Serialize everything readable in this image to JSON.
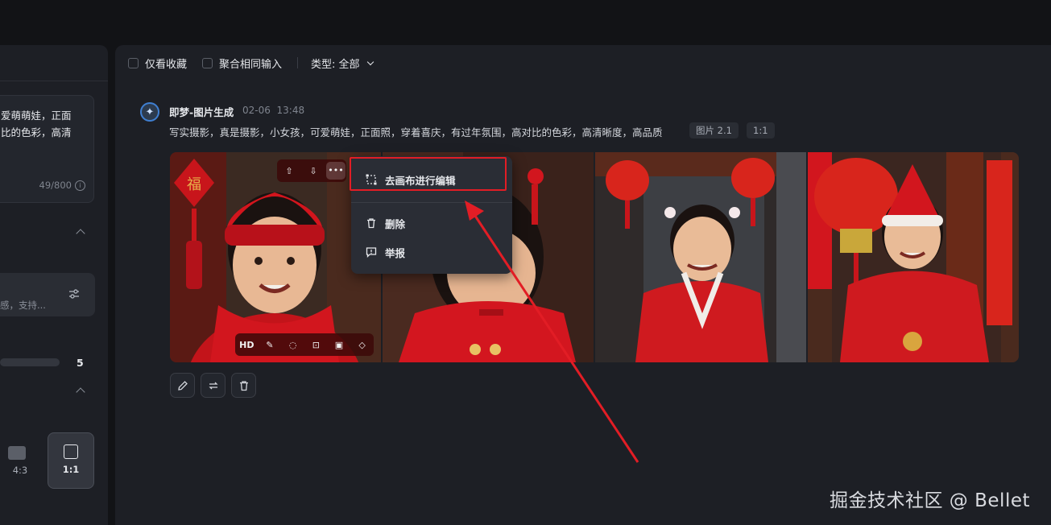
{
  "left_panel": {
    "prompt_text": "爱萌萌娃，正面\n比的色彩，高清",
    "char_count": "49/800",
    "reference_hint": "感，支持...",
    "count_value": "5",
    "ratios": [
      {
        "label": "4:3",
        "selected": false
      },
      {
        "label": "1:1",
        "selected": true
      }
    ]
  },
  "filters": {
    "favorites_only": "仅看收藏",
    "merge_same_input": "聚合相同输入",
    "type_label": "类型: 全部"
  },
  "generation": {
    "title": "即梦-图片生成",
    "date": "02-06",
    "time": "13:48",
    "prompt": "写实摄影，真是摄影，小女孩，可爱萌娃，正面照，穿着喜庆，有过年氛围，高对比的色彩，高清晰度，高品质",
    "model_tag": "图片 2.1",
    "ratio_tag": "1:1"
  },
  "image_toolbar": {
    "hd_label": "HD"
  },
  "context_menu": {
    "edit_on_canvas": "去画布进行编辑",
    "delete": "删除",
    "report": "举报"
  },
  "colors": {
    "accent_red": "#e21d25",
    "panel_bg": "#1d1f25",
    "page_bg": "#121316"
  },
  "watermark": "掘金技术社区 @ Bellet"
}
